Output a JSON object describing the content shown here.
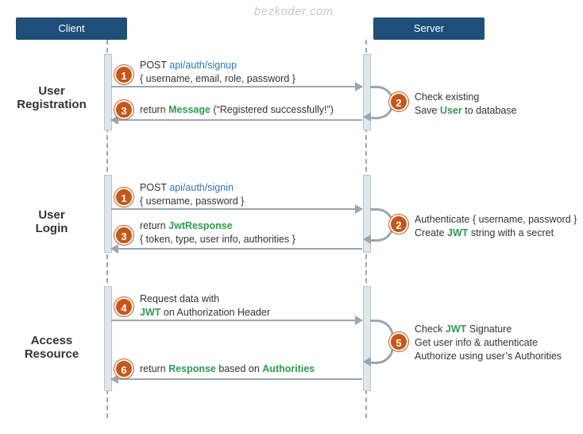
{
  "watermark": "bezkoder.com",
  "headers": {
    "client": "Client",
    "server": "Server"
  },
  "sections": {
    "registration": "User\nRegistration",
    "login": "User\nLogin",
    "resource": "Access\nResource"
  },
  "steps": {
    "reg_post": {
      "num": "1",
      "line1_pre": "POST ",
      "line1_link": "api/auth/signup",
      "line2": "{ username, email, role, password }"
    },
    "reg_server": {
      "num": "2",
      "line1": "Check existing",
      "line2_pre": "Save ",
      "line2_kw": "User",
      "line2_post": " to database"
    },
    "reg_return": {
      "num": "3",
      "pre": "return ",
      "kw": "Message",
      "post": " (“Registered successfully!”)"
    },
    "login_post": {
      "num": "1",
      "line1_pre": "POST ",
      "line1_link": "api/auth/signin",
      "line2": "{ username, password }"
    },
    "login_server": {
      "num": "2",
      "line1": "Authenticate { username, password }",
      "line2_pre": "Create ",
      "line2_kw": "JWT",
      "line2_post": " string with a secret"
    },
    "login_return": {
      "num": "3",
      "line1_pre": "return ",
      "line1_kw": "JwtResponse",
      "line2": "{ token, type, user info, authorities }"
    },
    "req": {
      "num": "4",
      "line1": "Request  data with",
      "line2_kw": "JWT",
      "line2_post": " on Authorization Header"
    },
    "res_server": {
      "num": "5",
      "line1_pre": "Check ",
      "line1_kw": "JWT",
      "line1_post": " Signature",
      "line2": "Get user info & authenticate",
      "line3": "Authorize using user’s Authorities"
    },
    "res_return": {
      "num": "6",
      "pre": "return ",
      "kw": "Response",
      "mid": " based on ",
      "kw2": "Authorities"
    }
  }
}
